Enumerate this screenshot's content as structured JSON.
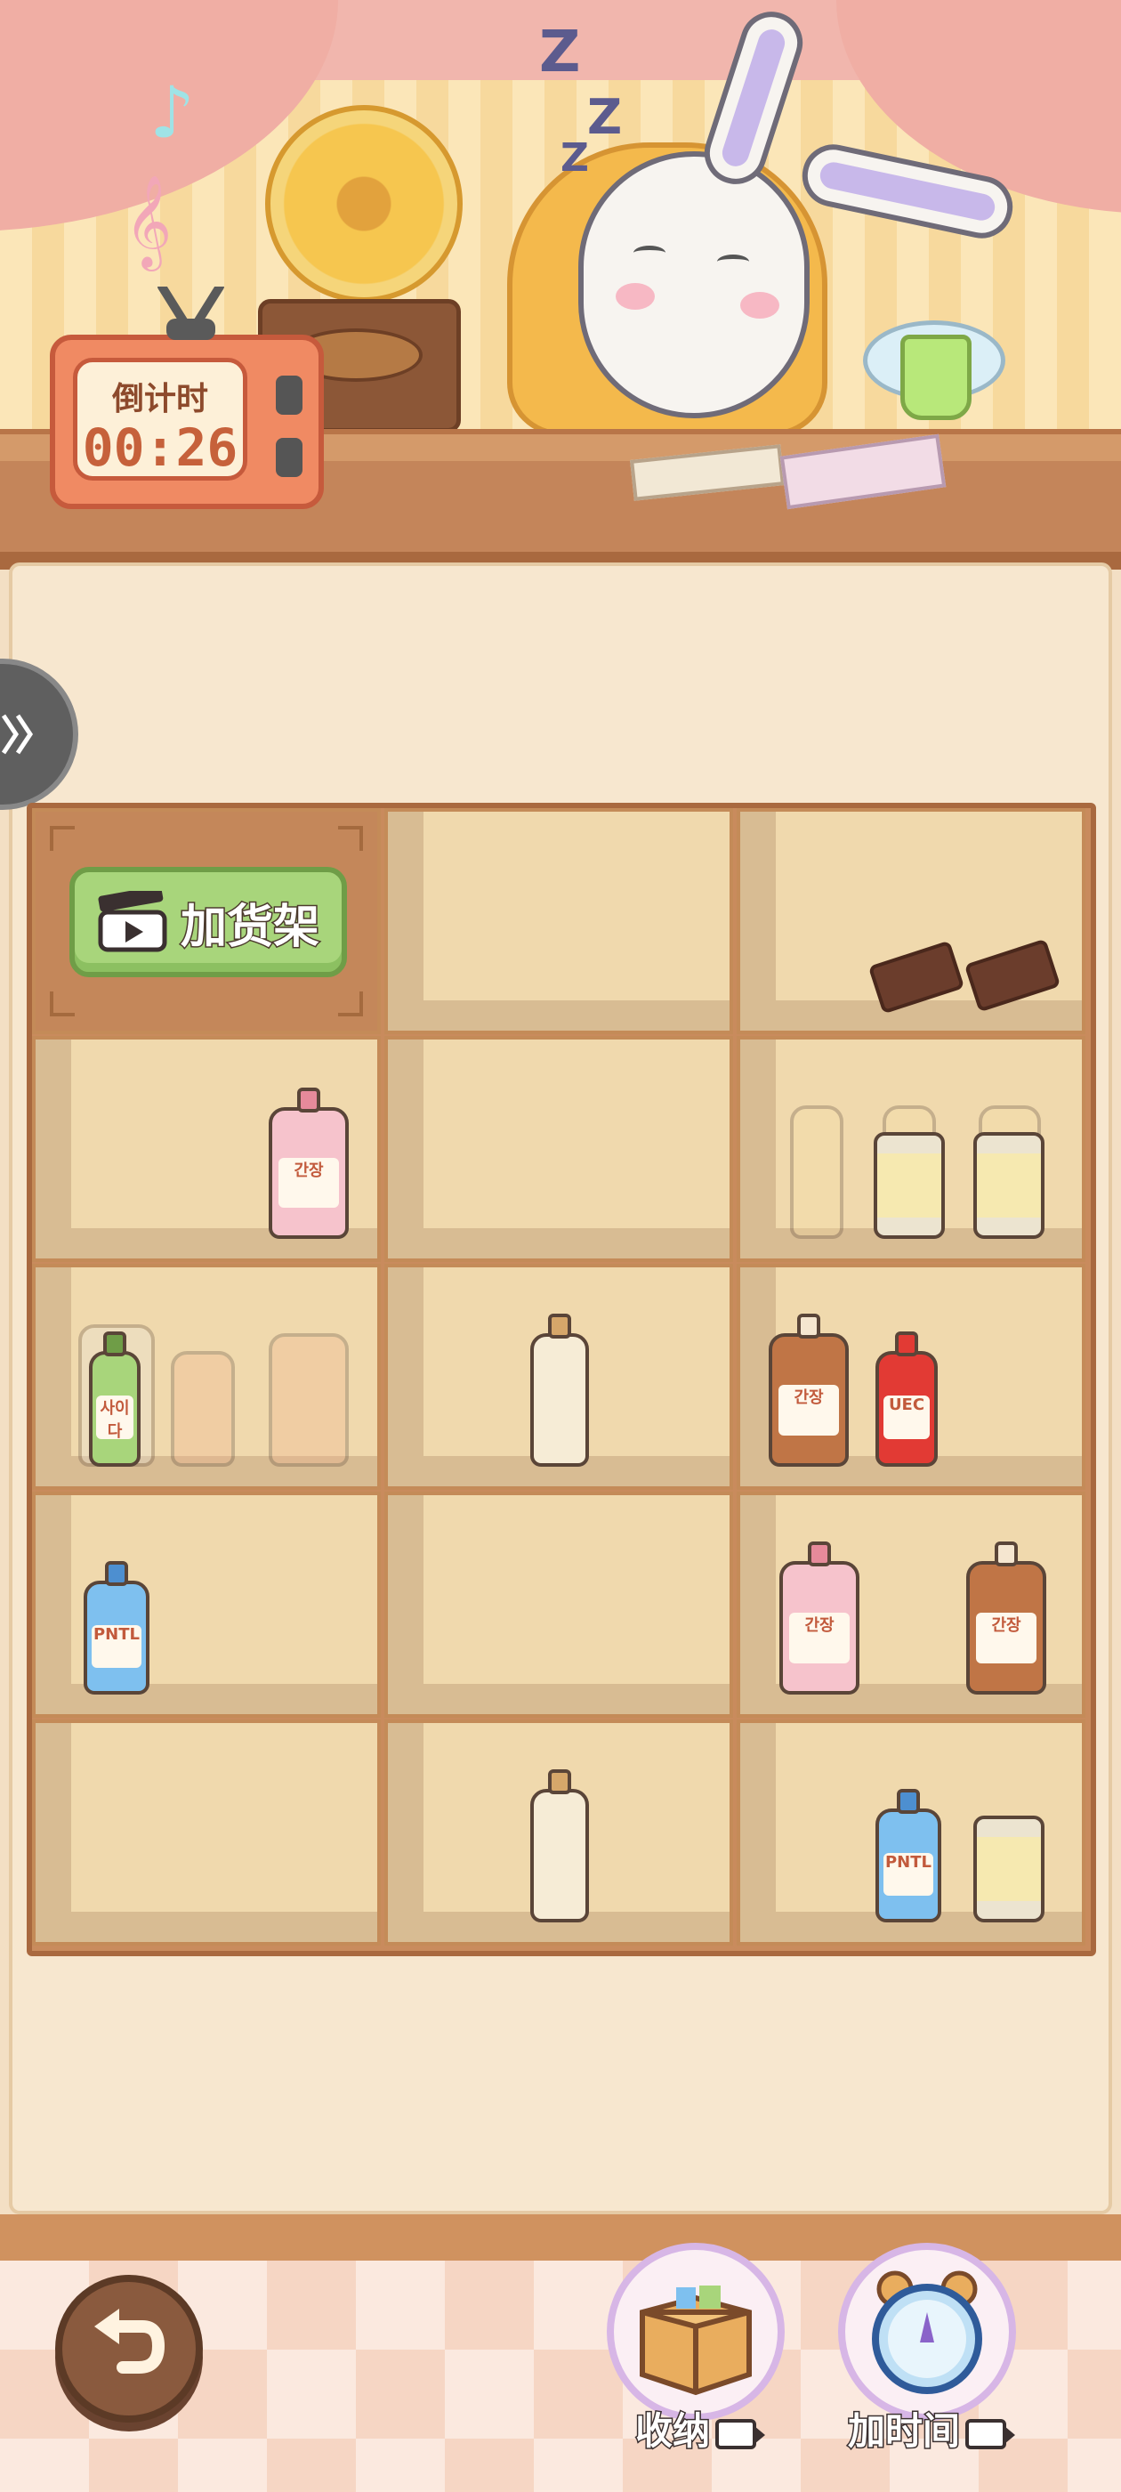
{
  "timer": {
    "label": "倒计时",
    "value": "00:26"
  },
  "expand_icon": "double-chevron-right-icon",
  "add_shelf": {
    "label": "加货架",
    "icon": "clapperboard-icon"
  },
  "tools": [
    {
      "label": "收纳",
      "icon": "box-icon",
      "ad_icon": "video-ad-icon"
    },
    {
      "label": "加时间",
      "icon": "alarm-clock-icon",
      "ad_icon": "video-ad-icon"
    }
  ],
  "back_icon": "undo-arrow-icon",
  "product_labels": {
    "sauce": "간장",
    "milk": "PNTL",
    "ketchup": "UEC",
    "soda": "사이다"
  },
  "colors": {
    "add_button": "#a8d57b",
    "shelf_wood": "#c98b5d",
    "shelf_back": "#f0d9ad",
    "timer_text": "#c6613b"
  }
}
